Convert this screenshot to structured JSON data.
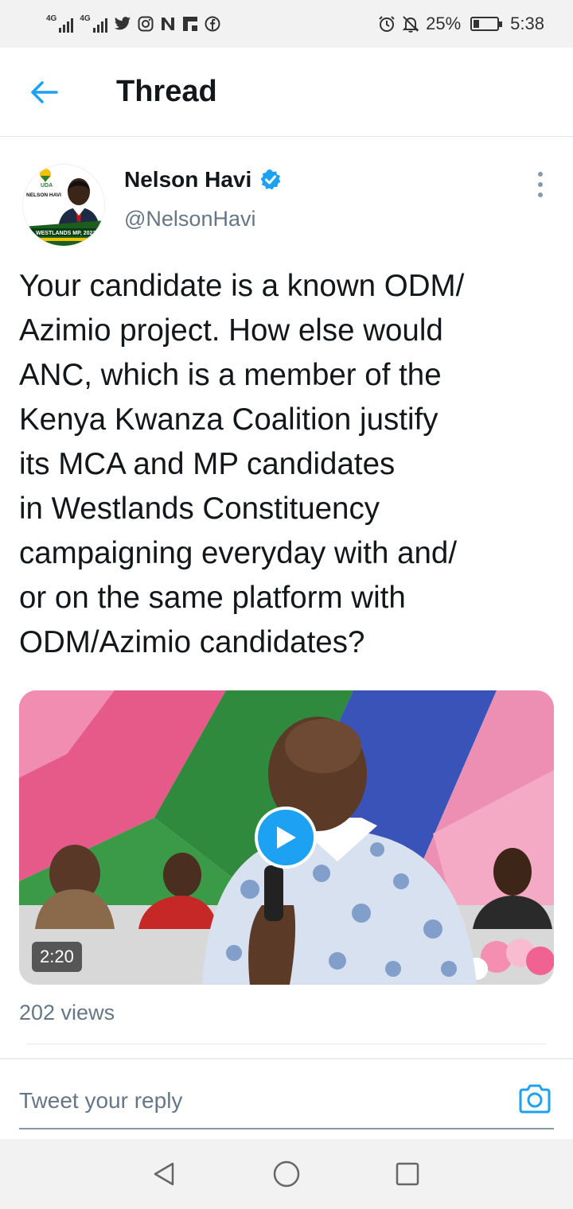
{
  "status_bar": {
    "network1": "4G",
    "network2": "4G",
    "battery_percent": "25%",
    "battery_level": 0.25,
    "time": "5:38",
    "notification_icons": [
      "twitter-icon",
      "instagram-icon",
      "newsapp-icon",
      "flipboard-icon",
      "facebook-icon"
    ],
    "right_icons": [
      "alarm-icon",
      "silent-bell-icon"
    ]
  },
  "header": {
    "title": "Thread",
    "back_icon": "arrow-left-icon"
  },
  "tweet": {
    "author_name": "Nelson Havi",
    "handle": "@NelsonHavi",
    "verified": true,
    "avatar": {
      "party": "UDA",
      "name_caption": "NELSON HAVI",
      "banner": "WESTLANDS MP, 2022"
    },
    "text": "Your candidate is a known ODM/\nAzimio project. How else would\nANC, which is a member of the\nKenya Kwanza Coalition justify\nits MCA and MP candidates\nin Westlands Constituency\ncampaigning everyday with and/\nor on the same platform with\nODM/Azimio candidates?",
    "media": {
      "type": "video",
      "duration": "2:20"
    },
    "views": "202 views"
  },
  "reply": {
    "placeholder": "Tweet your reply"
  },
  "colors": {
    "accent": "#1da1f2",
    "text_primary": "#14171a",
    "text_secondary": "#657786"
  }
}
